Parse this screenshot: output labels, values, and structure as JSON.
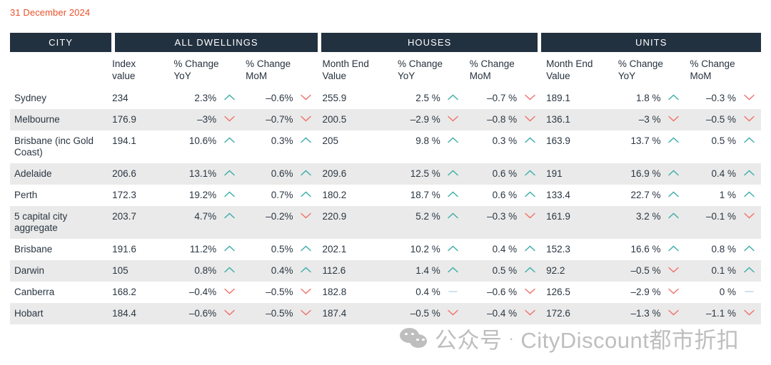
{
  "date_label": "31 December 2024",
  "colors": {
    "header_bg": "#223140",
    "date": "#E8512B",
    "up": "#3AADA8",
    "down": "#F2706B",
    "flat": "#BFD9E6",
    "row_shaded": "#EAEAEA",
    "text": "#2A3642"
  },
  "groups": {
    "city": "CITY",
    "all_dwellings": "ALL DWELLINGS",
    "houses": "HOUSES",
    "units": "UNITS"
  },
  "subheaders": {
    "index_value": [
      "Index",
      "value"
    ],
    "all_yoy": [
      "% Change",
      "YoY"
    ],
    "all_mom": [
      "% Change",
      "MoM"
    ],
    "houses_mev": [
      "Month End",
      "Value"
    ],
    "houses_yoy": [
      "% Change",
      "YoY"
    ],
    "houses_mom": [
      "% Change",
      "MoM"
    ],
    "units_mev": [
      "Month End",
      "Value"
    ],
    "units_yoy": [
      "% Change",
      "YoY"
    ],
    "units_mom": [
      "% Change",
      "MoM"
    ]
  },
  "rows": [
    {
      "city": "Sydney",
      "index_value": "234",
      "all_yoy": "2.3%",
      "all_yoy_dir": "up",
      "all_mom": "–0.6%",
      "all_mom_dir": "down",
      "houses_mev": "255.9",
      "houses_yoy": "2.5 %",
      "houses_yoy_dir": "up",
      "houses_mom": "–0.7 %",
      "houses_mom_dir": "down",
      "units_mev": "189.1",
      "units_yoy": "1.8 %",
      "units_yoy_dir": "up",
      "units_mom": "–0.3 %",
      "units_mom_dir": "down"
    },
    {
      "city": "Melbourne",
      "index_value": "176.9",
      "all_yoy": "–3%",
      "all_yoy_dir": "down",
      "all_mom": "–0.7%",
      "all_mom_dir": "down",
      "houses_mev": "200.5",
      "houses_yoy": "–2.9 %",
      "houses_yoy_dir": "down",
      "houses_mom": "–0.8 %",
      "houses_mom_dir": "down",
      "units_mev": "136.1",
      "units_yoy": "–3 %",
      "units_yoy_dir": "down",
      "units_mom": "–0.5 %",
      "units_mom_dir": "down"
    },
    {
      "city": "Brisbane (inc Gold Coast)",
      "index_value": "194.1",
      "all_yoy": "10.6%",
      "all_yoy_dir": "up",
      "all_mom": "0.3%",
      "all_mom_dir": "up",
      "houses_mev": "205",
      "houses_yoy": "9.8 %",
      "houses_yoy_dir": "up",
      "houses_mom": "0.3 %",
      "houses_mom_dir": "up",
      "units_mev": "163.9",
      "units_yoy": "13.7 %",
      "units_yoy_dir": "up",
      "units_mom": "0.5 %",
      "units_mom_dir": "up"
    },
    {
      "city": "Adelaide",
      "index_value": "206.6",
      "all_yoy": "13.1%",
      "all_yoy_dir": "up",
      "all_mom": "0.6%",
      "all_mom_dir": "up",
      "houses_mev": "209.6",
      "houses_yoy": "12.5 %",
      "houses_yoy_dir": "up",
      "houses_mom": "0.6 %",
      "houses_mom_dir": "up",
      "units_mev": "191",
      "units_yoy": "16.9 %",
      "units_yoy_dir": "up",
      "units_mom": "0.4 %",
      "units_mom_dir": "up"
    },
    {
      "city": "Perth",
      "index_value": "172.3",
      "all_yoy": "19.2%",
      "all_yoy_dir": "up",
      "all_mom": "0.7%",
      "all_mom_dir": "up",
      "houses_mev": "180.2",
      "houses_yoy": "18.7 %",
      "houses_yoy_dir": "up",
      "houses_mom": "0.6 %",
      "houses_mom_dir": "up",
      "units_mev": "133.4",
      "units_yoy": "22.7 %",
      "units_yoy_dir": "up",
      "units_mom": "1 %",
      "units_mom_dir": "up"
    },
    {
      "city": "5 capital city aggregate",
      "index_value": "203.7",
      "all_yoy": "4.7%",
      "all_yoy_dir": "up",
      "all_mom": "–0.2%",
      "all_mom_dir": "down",
      "houses_mev": "220.9",
      "houses_yoy": "5.2 %",
      "houses_yoy_dir": "up",
      "houses_mom": "–0.3 %",
      "houses_mom_dir": "down",
      "units_mev": "161.9",
      "units_yoy": "3.2 %",
      "units_yoy_dir": "up",
      "units_mom": "–0.1 %",
      "units_mom_dir": "down"
    },
    {
      "city": "Brisbane",
      "index_value": "191.6",
      "all_yoy": "11.2%",
      "all_yoy_dir": "up",
      "all_mom": "0.5%",
      "all_mom_dir": "up",
      "houses_mev": "202.1",
      "houses_yoy": "10.2 %",
      "houses_yoy_dir": "up",
      "houses_mom": "0.4 %",
      "houses_mom_dir": "up",
      "units_mev": "152.3",
      "units_yoy": "16.6 %",
      "units_yoy_dir": "up",
      "units_mom": "0.8 %",
      "units_mom_dir": "up"
    },
    {
      "city": "Darwin",
      "index_value": "105",
      "all_yoy": "0.8%",
      "all_yoy_dir": "up",
      "all_mom": "0.4%",
      "all_mom_dir": "up",
      "houses_mev": "112.6",
      "houses_yoy": "1.4 %",
      "houses_yoy_dir": "up",
      "houses_mom": "0.5 %",
      "houses_mom_dir": "up",
      "units_mev": "92.2",
      "units_yoy": "–0.5 %",
      "units_yoy_dir": "down",
      "units_mom": "0.1 %",
      "units_mom_dir": "up"
    },
    {
      "city": "Canberra",
      "index_value": "168.2",
      "all_yoy": "–0.4%",
      "all_yoy_dir": "down",
      "all_mom": "–0.5%",
      "all_mom_dir": "down",
      "houses_mev": "182.8",
      "houses_yoy": "0.4 %",
      "houses_yoy_dir": "flat",
      "houses_mom": "–0.6 %",
      "houses_mom_dir": "down",
      "units_mev": "126.5",
      "units_yoy": "–2.9 %",
      "units_yoy_dir": "down",
      "units_mom": "0 %",
      "units_mom_dir": "flat"
    },
    {
      "city": "Hobart",
      "index_value": "184.4",
      "all_yoy": "–0.6%",
      "all_yoy_dir": "down",
      "all_mom": "–0.5%",
      "all_mom_dir": "down",
      "houses_mev": "187.4",
      "houses_yoy": "–0.5 %",
      "houses_yoy_dir": "down",
      "houses_mom": "–0.4 %",
      "houses_mom_dir": "down",
      "units_mev": "172.6",
      "units_yoy": "–1.3 %",
      "units_yoy_dir": "down",
      "units_mom": "–1.1 %",
      "units_mom_dir": "down"
    }
  ],
  "watermark": {
    "text_left": "公众号",
    "separator": "·",
    "text_right": "CityDiscount都市折扣"
  }
}
